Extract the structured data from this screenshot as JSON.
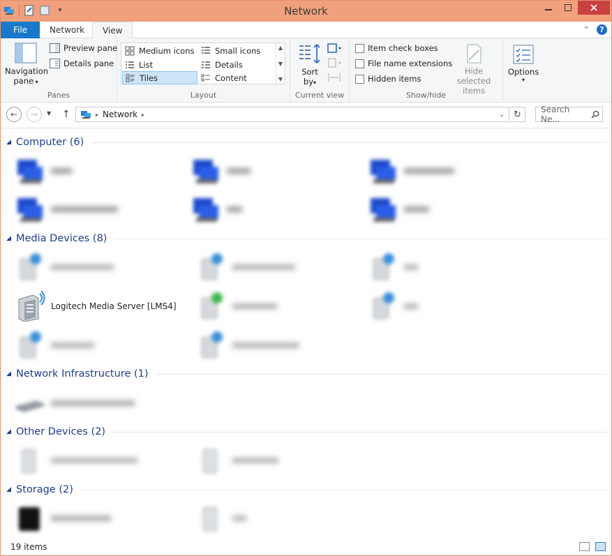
{
  "window": {
    "title": "Network"
  },
  "tabs": [
    {
      "label": "File"
    },
    {
      "label": "Network"
    },
    {
      "label": "View"
    }
  ],
  "ribbon": {
    "panes": {
      "label": "Panes",
      "navigation_pane": "Navigation pane",
      "navigation_pane_line1": "Navigation",
      "navigation_pane_line2": "pane",
      "preview_pane": "Preview pane",
      "details_pane": "Details pane"
    },
    "layout": {
      "label": "Layout",
      "options": [
        "Medium icons",
        "Small icons",
        "List",
        "Details",
        "Tiles",
        "Content"
      ],
      "selected": "Tiles"
    },
    "current_view": {
      "label": "Current view",
      "sort_by_line1": "Sort",
      "sort_by_line2": "by"
    },
    "show_hide": {
      "label": "Show/hide",
      "item_check_boxes": "Item check boxes",
      "file_name_extensions": "File name extensions",
      "hidden_items": "Hidden items",
      "hide_selected_line1": "Hide selected",
      "hide_selected_line2": "items"
    },
    "options": {
      "label": "Options"
    }
  },
  "address": {
    "path": [
      "Network"
    ],
    "search_placeholder": "Search Ne..."
  },
  "groups": [
    {
      "title": "Computer (6)"
    },
    {
      "title": "Media Devices (8)"
    },
    {
      "title": "Network Infrastructure (1)"
    },
    {
      "title": "Other Devices (2)"
    },
    {
      "title": "Storage (2)"
    }
  ],
  "visible_item": {
    "label": "Logitech Media Server [LMS4]"
  },
  "status": {
    "item_count": "19 items"
  },
  "colors": {
    "accent": "#1979ca",
    "titlebar": "#f0a07c",
    "group_heading": "#1e3d8f",
    "close": "#c94040"
  }
}
